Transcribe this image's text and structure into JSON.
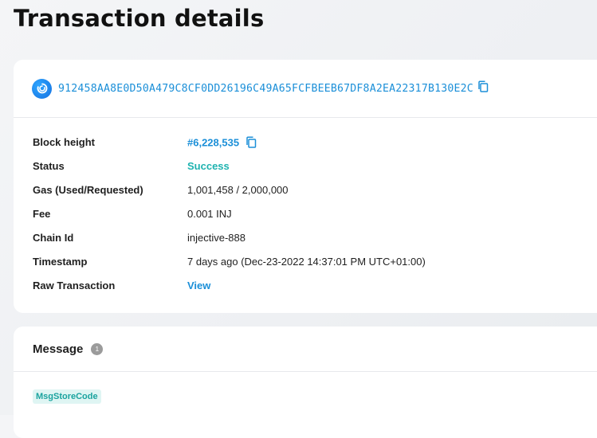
{
  "page": {
    "title": "Transaction details"
  },
  "tx": {
    "hash": "912458AA8E0D50A479C8CF0DD26196C49A65FCFBEEB67DF8A2EA22317B130E2C"
  },
  "details": {
    "block_height": {
      "label": "Block height",
      "value": "#6,228,535"
    },
    "status": {
      "label": "Status",
      "value": "Success"
    },
    "gas": {
      "label": "Gas (Used/Requested)",
      "value": "1,001,458 / 2,000,000"
    },
    "fee": {
      "label": "Fee",
      "value": "0.001 INJ"
    },
    "chain_id": {
      "label": "Chain Id",
      "value": "injective-888"
    },
    "timestamp": {
      "label": "Timestamp",
      "value": "7 days ago (Dec-23-2022 14:37:01 PM UTC+01:00)"
    },
    "raw_tx": {
      "label": "Raw Transaction",
      "value": "View"
    }
  },
  "message": {
    "title": "Message",
    "count": "1",
    "type": "MsgStoreCode"
  },
  "colors": {
    "link": "#1b8fd8",
    "success": "#1fb3b0",
    "badge": "#9b9b9b"
  },
  "icons": [
    "injective-logo-icon",
    "copy-icon"
  ]
}
